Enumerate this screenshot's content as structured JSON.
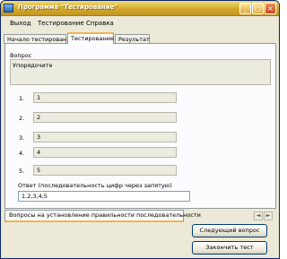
{
  "window": {
    "title": "Программа \"Тестирование\""
  },
  "title_buttons": {
    "minimize": "_",
    "maximize": "□",
    "close": "×"
  },
  "menu": {
    "items": [
      "Выход",
      "Тестирование",
      "Справка"
    ]
  },
  "tabs": {
    "items": [
      "Начало тестирования",
      "Тестирование",
      "Результат"
    ],
    "active": "Тестирование"
  },
  "question": {
    "label": "Вопрос",
    "text": "Упорядочите"
  },
  "answers": [
    {
      "number": "1.",
      "value": "1"
    },
    {
      "number": "2.",
      "value": "2"
    },
    {
      "number": "3.",
      "value": "3"
    },
    {
      "number": "4.",
      "value": "4"
    },
    {
      "number": "5.",
      "value": "5"
    }
  ],
  "answer_input": {
    "label": "Ответ (последовательность цифр через запятую)",
    "value": "1,2,3,4,5"
  },
  "bottom_tabs": {
    "active": "Вопросы на установление правильности последовательности",
    "left_arrow": "◄",
    "right_arrow": "►"
  },
  "buttons": {
    "next_question": "Следующий вопрос",
    "finish_test": "Закончить тест"
  },
  "colors": {
    "titlebar": "#d2a92c",
    "tab_highlight": "#f2b44a",
    "window_bg": "#ece9d8"
  }
}
